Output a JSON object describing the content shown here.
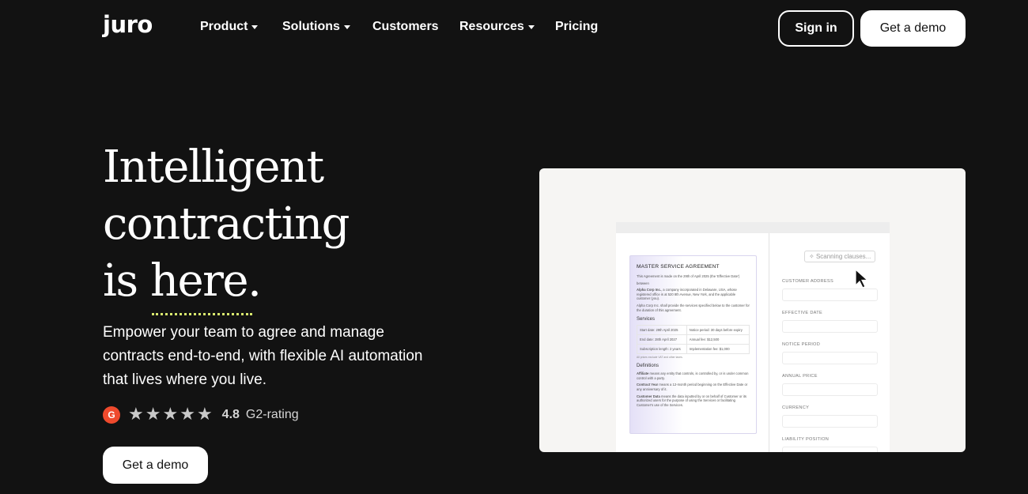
{
  "brand": {
    "logo": "juro"
  },
  "nav": {
    "items": [
      {
        "label": "Product",
        "has_dropdown": true
      },
      {
        "label": "Solutions",
        "has_dropdown": true
      },
      {
        "label": "Customers",
        "has_dropdown": false
      },
      {
        "label": "Resources",
        "has_dropdown": true
      },
      {
        "label": "Pricing",
        "has_dropdown": false
      }
    ],
    "sign_in": "Sign in",
    "get_demo": "Get a demo"
  },
  "hero": {
    "headline_line1": "Intelligent",
    "headline_line2": "contracting",
    "headline_line3_prefix": "is ",
    "headline_line3_word": "here",
    "headline_line3_suffix": ".",
    "subtext": "Empower your team to agree and manage contracts end-to-end, with flexible AI automation that lives where you live.",
    "rating": {
      "badge": "G",
      "stars": 5,
      "value": "4.8",
      "label": "G2-rating"
    },
    "cta": "Get a demo"
  },
  "preview": {
    "doc": {
      "title": "MASTER SERVICE AGREEMENT",
      "intro": "This Agreement is made on the 29th of April 2025 (the 'Effective Date')",
      "between": "between",
      "party1_name": "Alpha Corp Inc.",
      "party1_text": ", a company incorporated in Delaware, USA, whose registered office is at 520 8th Avenue, New York, and the applicable customer (you).",
      "party2_text": "Alpha Corp Inc. shall provide the services specified below to the customer for the duration of this agreement.",
      "services_heading": "Services",
      "table": [
        [
          "Start date: 29th April 2025",
          "Notice period: 30 days before expiry"
        ],
        [
          "End date: 28th April 2027",
          "Annual fee: $12,500"
        ],
        [
          "Subscription length: 2 years",
          "Implementation fee: $1,000"
        ]
      ],
      "table_note": "All prices exclude VAT and other taxes.",
      "definitions_heading": "Definitions",
      "definitions": [
        {
          "term": "Affiliate",
          "text": " means any entity that controls, is controlled by, or is under common control with a party."
        },
        {
          "term": "Contract Year",
          "text": " means a 12-month period beginning on the Effective Date or any anniversary of it."
        },
        {
          "term": "Customer Data",
          "text": " means the data inputted by or on behalf of Customer or its authorized users for the purpose of using the Services or facilitating Customer's use of the Services."
        }
      ]
    },
    "scan_chip": "Scanning clauses...",
    "fields": [
      "CUSTOMER ADDRESS",
      "EFFECTIVE DATE",
      "NOTICE PERIOD",
      "ANNUAL PRICE",
      "CURRENCY",
      "LIABILITY POSITION"
    ]
  },
  "colors": {
    "background": "#121212",
    "accent_underline": "#d8e86e",
    "g2_badge": "#ef4a2d",
    "doc_highlight": "#e4e0f7"
  },
  "icons": [
    "caret-down-icon",
    "star-icon",
    "g2-logo-icon",
    "cursor-arrow-icon",
    "sparkle-icon"
  ]
}
